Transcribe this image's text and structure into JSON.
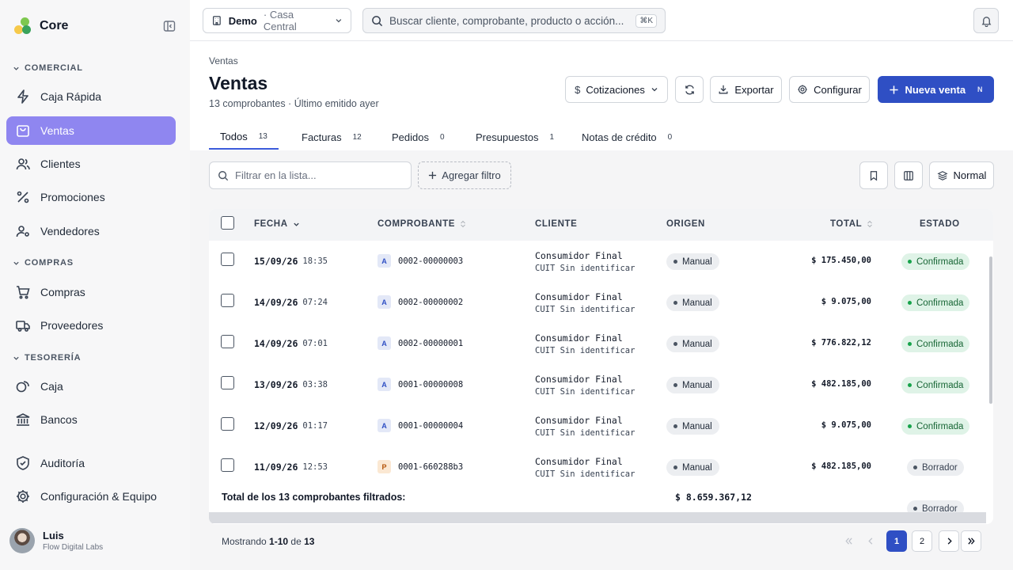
{
  "app": {
    "name": "Core"
  },
  "sidebar": {
    "sections": [
      {
        "label": "COMERCIAL"
      },
      {
        "label": "COMPRAS"
      },
      {
        "label": "TESORERÍA"
      }
    ],
    "items": [
      {
        "label": "Caja Rápida",
        "icon": "zap-icon"
      },
      {
        "label": "Ventas",
        "icon": "bag-icon",
        "active": true
      },
      {
        "label": "Clientes",
        "icon": "users-icon"
      },
      {
        "label": "Promociones",
        "icon": "percent-icon"
      },
      {
        "label": "Vendedores",
        "icon": "user-cog-icon"
      },
      {
        "label": "Compras",
        "icon": "cart-icon"
      },
      {
        "label": "Proveedores",
        "icon": "truck-icon"
      },
      {
        "label": "Caja",
        "icon": "coins-icon"
      },
      {
        "label": "Bancos",
        "icon": "bank-icon"
      },
      {
        "label": "Auditoría",
        "icon": "shield-icon"
      },
      {
        "label": "Configuración & Equipo",
        "icon": "gear-icon"
      }
    ],
    "user": {
      "name": "Luis",
      "org": "Flow Digital Labs"
    }
  },
  "topbar": {
    "tenant": "Demo",
    "branch": "· Casa Central",
    "search_placeholder": "Buscar cliente, comprobante, producto o acción...",
    "search_shortcut": "⌘K"
  },
  "page": {
    "breadcrumb": "Ventas",
    "title": "Ventas",
    "subtitle": "13 comprobantes · Último emitido ayer"
  },
  "actions": {
    "quotes": "Cotizaciones",
    "export": "Exportar",
    "configure": "Configurar",
    "new_sale": "Nueva venta",
    "new_sale_shortcut": "N"
  },
  "tabs": [
    {
      "label": "Todos",
      "count": "13",
      "active": true
    },
    {
      "label": "Facturas",
      "count": "12"
    },
    {
      "label": "Pedidos",
      "count": "0"
    },
    {
      "label": "Presupuestos",
      "count": "1"
    },
    {
      "label": "Notas de crédito",
      "count": "0"
    }
  ],
  "toolbar": {
    "filter_placeholder": "Filtrar en la lista...",
    "add_filter": "Agregar filtro",
    "density": "Normal"
  },
  "table": {
    "columns": {
      "fecha": "FECHA",
      "comprobante": "COMPROBANTE",
      "cliente": "CLIENTE",
      "origen": "ORIGEN",
      "total": "TOTAL",
      "estado": "ESTADO"
    },
    "rows": [
      {
        "date": "15/09/26",
        "time": "18:35",
        "type": "A",
        "number": "0002-00000003",
        "client": "Consumidor Final",
        "client_id": "CUIT Sin identificar",
        "origin": "Manual",
        "total": "$ 175.450,00",
        "status": "Confirmada",
        "status_kind": "ok"
      },
      {
        "date": "14/09/26",
        "time": "07:24",
        "type": "A",
        "number": "0002-00000002",
        "client": "Consumidor Final",
        "client_id": "CUIT Sin identificar",
        "origin": "Manual",
        "total": "$ 9.075,00",
        "status": "Confirmada",
        "status_kind": "ok"
      },
      {
        "date": "14/09/26",
        "time": "07:01",
        "type": "A",
        "number": "0002-00000001",
        "client": "Consumidor Final",
        "client_id": "CUIT Sin identificar",
        "origin": "Manual",
        "total": "$ 776.822,12",
        "status": "Confirmada",
        "status_kind": "ok"
      },
      {
        "date": "13/09/26",
        "time": "03:38",
        "type": "A",
        "number": "0001-00000008",
        "client": "Consumidor Final",
        "client_id": "CUIT Sin identificar",
        "origin": "Manual",
        "total": "$ 482.185,00",
        "status": "Confirmada",
        "status_kind": "ok"
      },
      {
        "date": "12/09/26",
        "time": "01:17",
        "type": "A",
        "number": "0001-00000004",
        "client": "Consumidor Final",
        "client_id": "CUIT Sin identificar",
        "origin": "Manual",
        "total": "$ 9.075,00",
        "status": "Confirmada",
        "status_kind": "ok"
      },
      {
        "date": "11/09/26",
        "time": "12:53",
        "type": "P",
        "number": "0001-660288b3",
        "client": "Consumidor Final",
        "client_id": "CUIT Sin identificar",
        "origin": "Manual",
        "total": "$ 482.185,00",
        "status": "Borrador",
        "status_kind": "draft"
      }
    ],
    "partial_status": "Borrador",
    "summary_label": "Total de los 13 comprobantes filtrados:",
    "summary_total": "$ 8.659.367,12"
  },
  "pagination": {
    "showing_prefix": "Mostrando ",
    "range": "1-10",
    "of": " de ",
    "total": "13",
    "pages": [
      "1",
      "2"
    ],
    "current": "1"
  },
  "colors": {
    "primary": "#2f4fc4",
    "active_nav": "#8f86f0",
    "confirmed": "#16a34a"
  }
}
